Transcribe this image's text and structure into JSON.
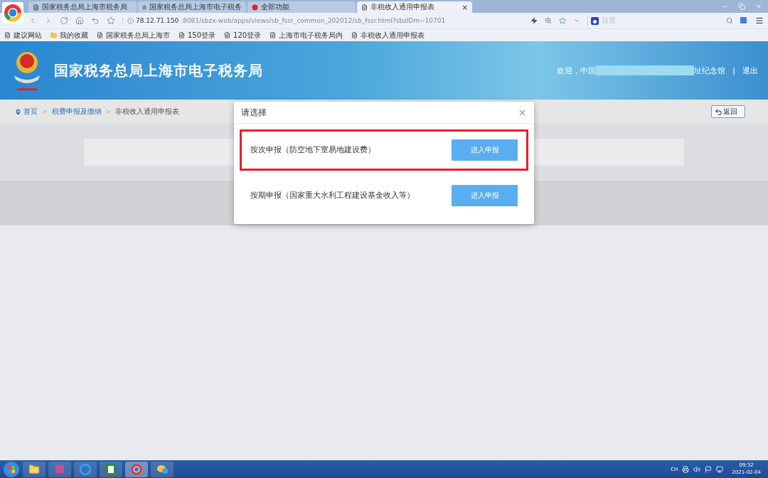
{
  "browser": {
    "tabs": [
      {
        "title": "国家税务总局上海市税务局",
        "selected": false,
        "kind": "page"
      },
      {
        "title": "国家税务总局上海市电子税务",
        "selected": false,
        "kind": "page"
      },
      {
        "title": "全部功能",
        "selected": false,
        "kind": "emblem"
      },
      {
        "title": "非税收入通用申报表",
        "selected": true,
        "kind": "page"
      }
    ],
    "close_tab": "×",
    "url_host": "78.12.71.150",
    "url_rest": ":8081/sbzx-web/apps/views/sb_fssr_common_202012/sb_fssr.html?sbzlDm=10701",
    "search_placeholder": "百度",
    "bookmarks": [
      {
        "title": "建议网站",
        "kind": "page"
      },
      {
        "title": "我的收藏",
        "kind": "folder"
      },
      {
        "title": "国家税务总局上海市",
        "kind": "page"
      },
      {
        "title": "150登录",
        "kind": "page"
      },
      {
        "title": "120登录",
        "kind": "page"
      },
      {
        "title": "上海市电子税务局内",
        "kind": "page"
      },
      {
        "title": "非税收入通用申报表",
        "kind": "page"
      }
    ]
  },
  "header": {
    "title": "国家税务总局上海市电子税务局",
    "welcome_start": "欢迎，中国",
    "welcome_end": "址纪念馆",
    "separator": "|",
    "logout": "退出"
  },
  "breadcrumb": {
    "items": [
      "首页",
      "税费申报及缴纳",
      "非税收入通用申报表"
    ],
    "separator": ">",
    "back": "返回"
  },
  "dialog": {
    "title": "请选择",
    "options": [
      {
        "label": "按次申报（防空地下室易地建设费）",
        "button": "进入申报",
        "highlighted": true
      },
      {
        "label": "按期申报（国家重大水利工程建设基金收入等）",
        "button": "进入申报",
        "highlighted": false
      }
    ]
  },
  "taskbar": {
    "ime": "CH",
    "time": "09:32",
    "date": "2021-02-04"
  }
}
